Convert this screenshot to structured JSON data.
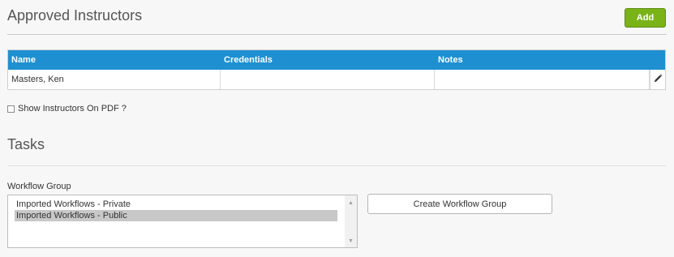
{
  "approved_instructors": {
    "title": "Approved Instructors",
    "add_label": "Add",
    "columns": [
      "Name",
      "Credentials",
      "Notes"
    ],
    "rows": [
      {
        "name": "Masters, Ken",
        "credentials": "",
        "notes": "",
        "edit_icon": "pencil-icon"
      }
    ],
    "show_on_pdf_label": "Show Instructors On PDF ?",
    "show_on_pdf_checked": false
  },
  "tasks": {
    "title": "Tasks",
    "workflow_group_label": "Workflow Group",
    "workflow_groups": [
      {
        "label": "Imported Workflows - Private",
        "selected": false
      },
      {
        "label": "Imported Workflows - Public",
        "selected": true
      }
    ],
    "create_label": "Create Workflow Group"
  },
  "colors": {
    "header_blue": "#1e90d2",
    "add_green": "#7ab317"
  }
}
